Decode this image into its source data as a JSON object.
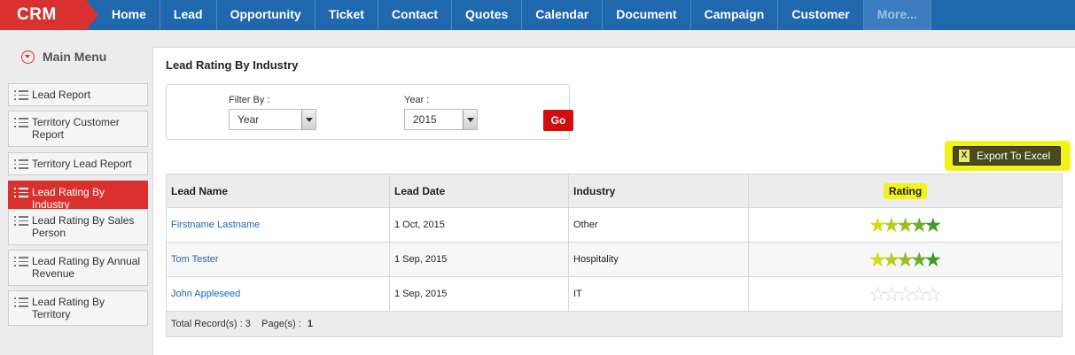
{
  "nav": {
    "brand": "CRM",
    "items": [
      {
        "label": "Home"
      },
      {
        "label": "Lead"
      },
      {
        "label": "Opportunity"
      },
      {
        "label": "Ticket"
      },
      {
        "label": "Contact"
      },
      {
        "label": "Quotes"
      },
      {
        "label": "Calendar"
      },
      {
        "label": "Document"
      },
      {
        "label": "Campaign"
      },
      {
        "label": "Customer"
      },
      {
        "label": "More..."
      }
    ]
  },
  "sidebar": {
    "title": "Main Menu",
    "items": [
      {
        "label": "Lead Report"
      },
      {
        "label": "Territory Customer Report"
      },
      {
        "label": "Territory Lead Report"
      },
      {
        "label": "Lead Rating By Industry"
      },
      {
        "label": "Lead Rating By Sales Person"
      },
      {
        "label": "Lead Rating By Annual Revenue"
      },
      {
        "label": "Lead Rating By Territory"
      }
    ],
    "active_index": 3
  },
  "page": {
    "title": "Lead Rating By Industry"
  },
  "filter": {
    "filter_by_label": "Filter By :",
    "filter_by_value": "Year",
    "year_label": "Year :",
    "year_value": "2015",
    "go_label": "Go"
  },
  "export": {
    "label": "Export To Excel",
    "icon": "excel-icon"
  },
  "table": {
    "headers": {
      "lead_name": "Lead Name",
      "lead_date": "Lead Date",
      "industry": "Industry",
      "rating": "Rating"
    },
    "rows": [
      {
        "lead_name": "Firstname Lastname",
        "lead_date": "1 Oct, 2015",
        "industry": "Other",
        "rating": 5
      },
      {
        "lead_name": "Tom Tester",
        "lead_date": "1 Sep, 2015",
        "industry": "Hospitality",
        "rating": 5
      },
      {
        "lead_name": "John Appleseed",
        "lead_date": "1 Sep, 2015",
        "industry": "IT",
        "rating": 0
      }
    ],
    "footer": {
      "total_label": "Total Record(s) :",
      "total_value": "3",
      "pages_label": "Page(s) :",
      "pages_value": "1"
    }
  },
  "colors": {
    "nav_bg": "#1f68ae",
    "brand_red": "#d9312f",
    "highlight": "#f3f317",
    "star_colors": [
      "#d4dc1a",
      "#b7ce1f",
      "#95bf23",
      "#6fae24",
      "#3f9a25"
    ],
    "star_empty": "#ffffff"
  }
}
